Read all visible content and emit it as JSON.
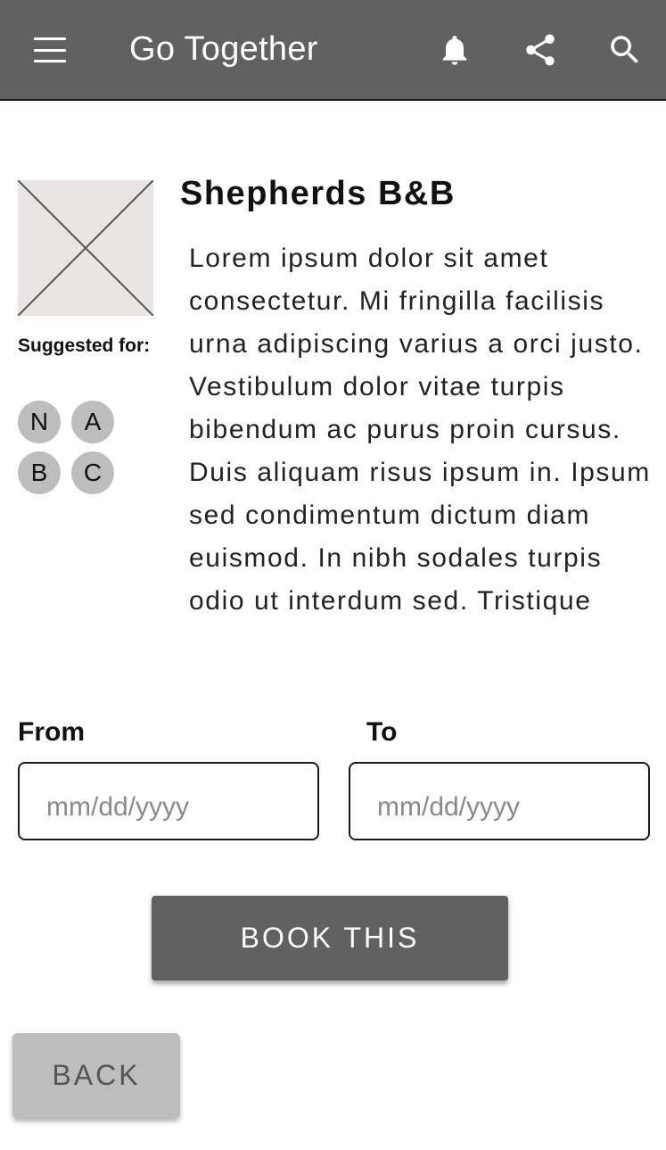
{
  "appbar": {
    "title": "Go Together",
    "icons": [
      "menu-icon",
      "bell-icon",
      "share-icon",
      "search-icon"
    ]
  },
  "listing": {
    "title": "Shepherds B&B",
    "description": "Lorem ipsum dolor sit amet consectetur. Mi fringilla facilisis urna adipiscing varius a orci justo. Vestibulum dolor vitae turpis bibendum ac purus proin cursus. Duis aliquam risus ipsum in. Ipsum sed condimentum dictum diam euismod. In nibh sodales turpis odio ut interdum sed. Tristique",
    "suggested_label": "Suggested for:",
    "suggested_users": [
      "N",
      "A",
      "B",
      "C"
    ]
  },
  "dates": {
    "from_label": "From",
    "to_label": "To",
    "from_placeholder": "mm/dd/yyyy",
    "to_placeholder": "mm/dd/yyyy"
  },
  "actions": {
    "book_label": "BOOK THIS",
    "back_label": "BACK"
  },
  "colors": {
    "appbar": "#616161",
    "primary_button": "#616161",
    "secondary_button": "#bdbdbd",
    "avatar": "#bdbdbd"
  }
}
